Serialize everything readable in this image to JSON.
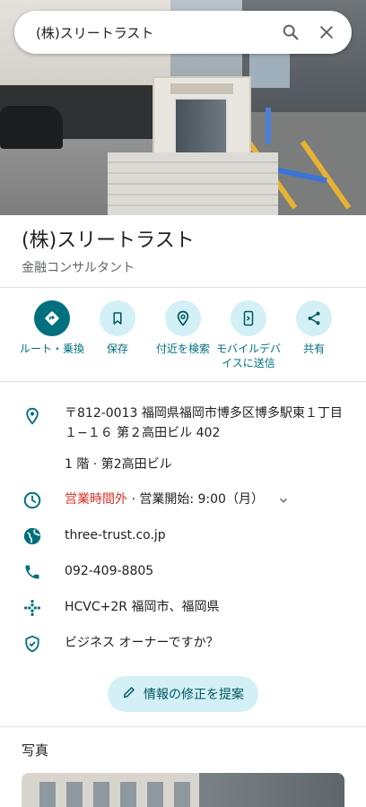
{
  "search": {
    "query": "(株)スリートラスト"
  },
  "icons": {
    "search": "search-icon",
    "close": "close-icon",
    "directions": "directions-icon",
    "save": "bookmark-icon",
    "nearby": "nearby-icon",
    "send": "send-to-phone-icon",
    "share": "share-icon",
    "location": "location-pin-icon",
    "hours": "clock-icon",
    "website": "globe-icon",
    "phone": "phone-icon",
    "pluscode": "plus-code-icon",
    "owner": "verified-shield-icon",
    "edit": "pencil-icon",
    "expand": "chevron-down-icon"
  },
  "place": {
    "name": "(株)スリートラスト",
    "category": "金融コンサルタント"
  },
  "actions": [
    {
      "label": "ルート・乗換"
    },
    {
      "label": "保存"
    },
    {
      "label": "付近を検索"
    },
    {
      "label": "モバイルデバイスに送信"
    },
    {
      "label": "共有"
    }
  ],
  "details": {
    "address": "〒812-0013 福岡県福岡市博多区博多駅東１丁目１−１６ 第２高田ビル 402",
    "floor": "1 階 · 第2高田ビル",
    "hours_status": "営業時間外",
    "hours_next": " · 営業開始: 9:00（月）",
    "website": "three-trust.co.jp",
    "phone": "092-409-8805",
    "plus_code": "HCVC+2R 福岡市、福岡県",
    "owner_prompt": "ビジネス オーナーですか？"
  },
  "suggest_edit": "情報の修正を提案",
  "photos": {
    "title": "写真"
  },
  "colors": {
    "accent": "#00707f",
    "accent_light": "#d2f0f6",
    "closed": "#d93025"
  }
}
